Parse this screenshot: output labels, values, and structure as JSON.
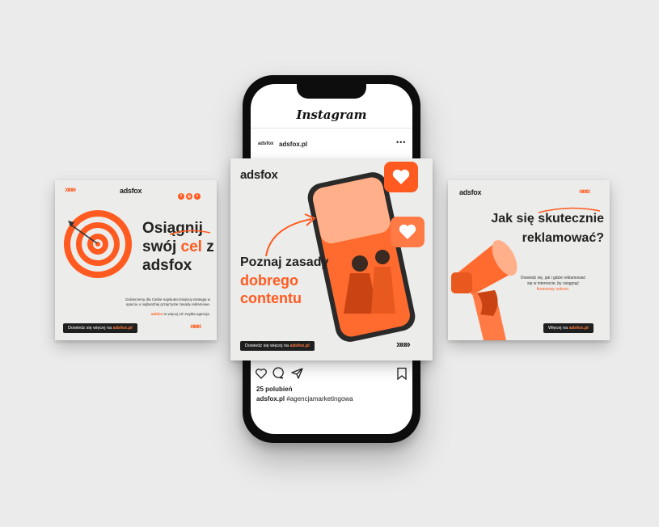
{
  "instagram": {
    "app_title": "Instagram",
    "avatar_text": "adsfox",
    "username": "adsfox.pl",
    "more": "•••",
    "likes": "25 polubień",
    "caption_user": "adsfox.pl",
    "caption_tag": "#agencjamarketingowa"
  },
  "left_card": {
    "logo": "adsfox",
    "headline_1": "Osiągnij",
    "headline_2a": "swój ",
    "headline_2b": "cel",
    "headline_2c": " z",
    "headline_3": "adsfox",
    "body_1": "Dobierzemy dla Ciebie najskuteczniejszą strategię w",
    "body_2": "oparciu o najbardziej przejrzyste zasady reklamowe.",
    "brand_line_a": "adsfox",
    "brand_line_b": " to więcej niż zwykła agencja.",
    "cta_text": "Dowiedz się więcej na ",
    "cta_link": "adsfox.pl",
    "chevrons_top": "»»»",
    "chevrons_bottom": "«««",
    "social_icons": [
      "facebook-icon",
      "instagram-icon",
      "twitter-icon"
    ]
  },
  "center_card": {
    "logo": "adsfox",
    "headline_1": "Poznaj zasady",
    "headline_2": "dobrego",
    "headline_3": "contentu",
    "cta_text": "Dowiedz się więcej na ",
    "cta_link": "adsfox.pl",
    "chevrons": "»»»"
  },
  "right_card": {
    "logo": "adsfox",
    "headline_1a": "Jak się ",
    "headline_1b": "skutecznie",
    "headline_2": "reklamować?",
    "body_1": "Dowiedz się, jak i gdzie reklamować",
    "body_2": "się w internecie, by osiągnąć",
    "body_highlight": "finansowy sukces.",
    "cta_text": "Więcej na ",
    "cta_link": "adsfox.pl",
    "chevrons": "«««"
  },
  "colors": {
    "accent": "#ff5a1f",
    "dark": "#1f1f1f",
    "card_bg": "#ececea",
    "page_bg": "#ebebeb"
  }
}
